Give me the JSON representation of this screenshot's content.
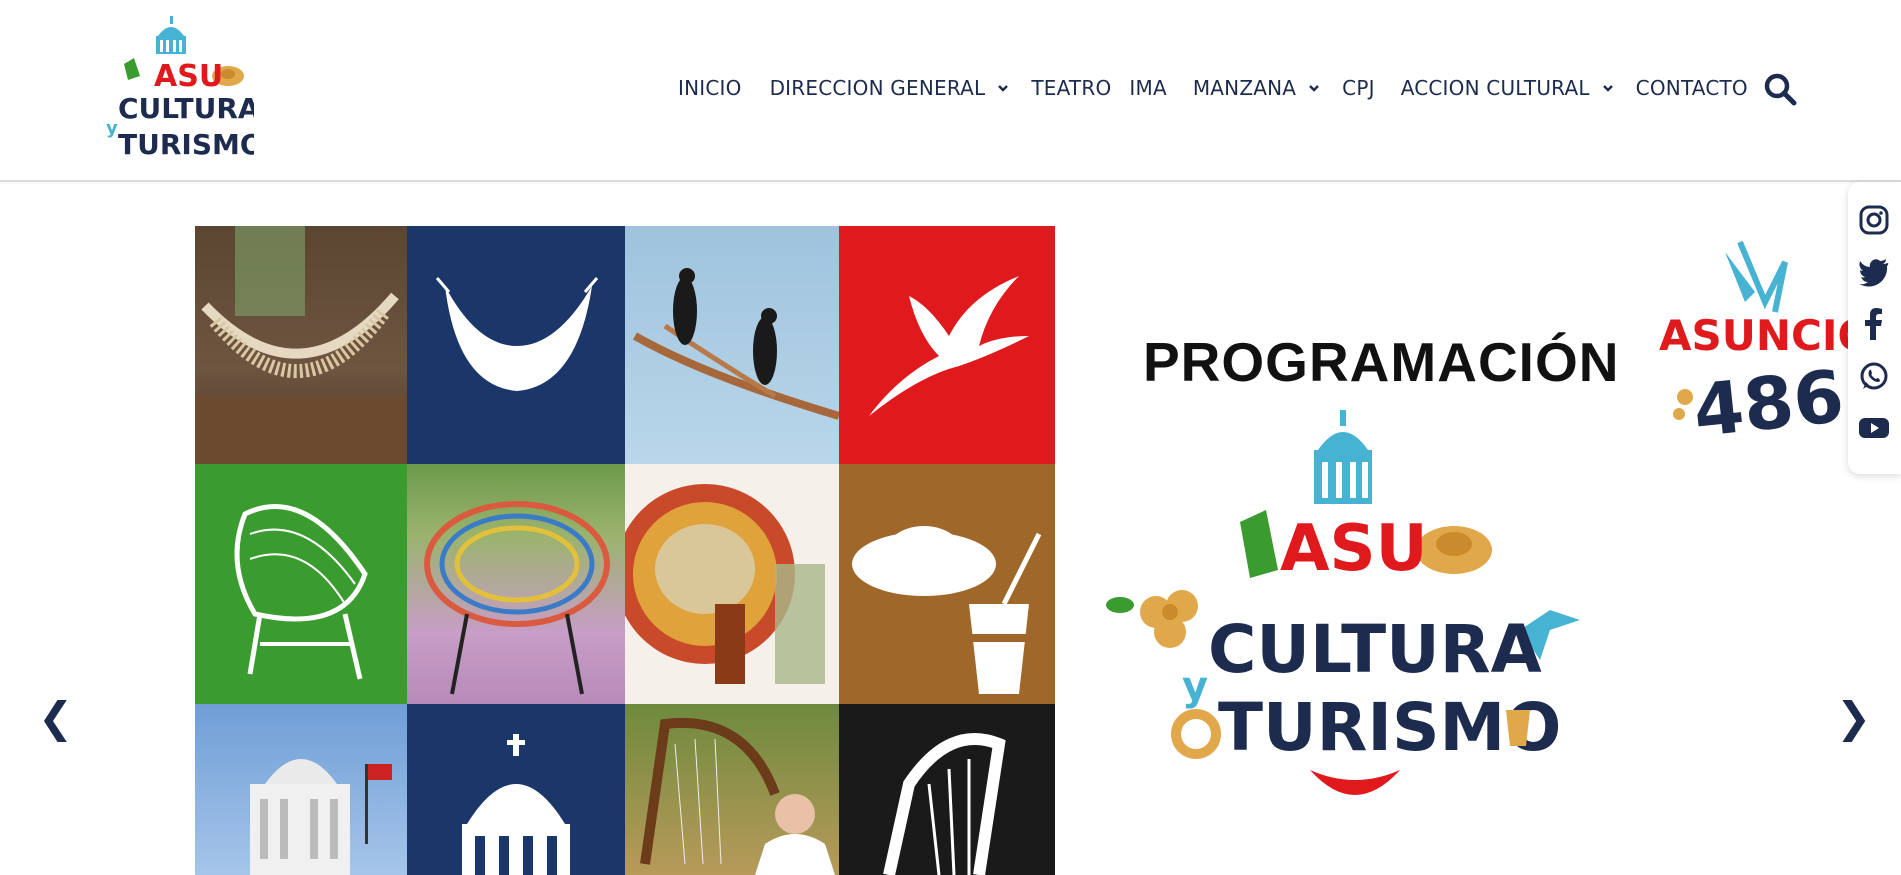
{
  "logo": {
    "line1": "ASU",
    "line2": "CULTURA",
    "connector": "y",
    "line3": "TURISMO"
  },
  "nav": {
    "items": [
      {
        "label": "INICIO",
        "has_dropdown": false
      },
      {
        "label": "DIRECCION GENERAL",
        "has_dropdown": true
      },
      {
        "label": "TEATRO",
        "has_dropdown": false
      },
      {
        "label": "IMA",
        "has_dropdown": false
      },
      {
        "label": "MANZANA",
        "has_dropdown": true
      },
      {
        "label": "CPJ",
        "has_dropdown": false
      },
      {
        "label": "ACCION CULTURAL",
        "has_dropdown": true
      },
      {
        "label": "CONTACTO",
        "has_dropdown": false
      }
    ],
    "search_icon": "search-icon"
  },
  "social": [
    "instagram-icon",
    "twitter-icon",
    "facebook-icon",
    "whatsapp-icon",
    "youtube-icon"
  ],
  "slider": {
    "prev": "❮",
    "next": "❯",
    "heading": "PROGRAMACIÓN",
    "badge_line1": "ASUNCIÓN",
    "badge_line2": "486",
    "main_logo": {
      "line1": "ASU",
      "line2": "CULTURA",
      "connector": "y",
      "line3": "TURISMO"
    }
  },
  "colors": {
    "navy": "#1d2b4f",
    "red": "#e0191c",
    "green": "#3a9b2f",
    "brown": "#a0672b",
    "teal": "#46b3d3",
    "blue_tile": "#1b3668",
    "gold": "#e0a84a"
  }
}
